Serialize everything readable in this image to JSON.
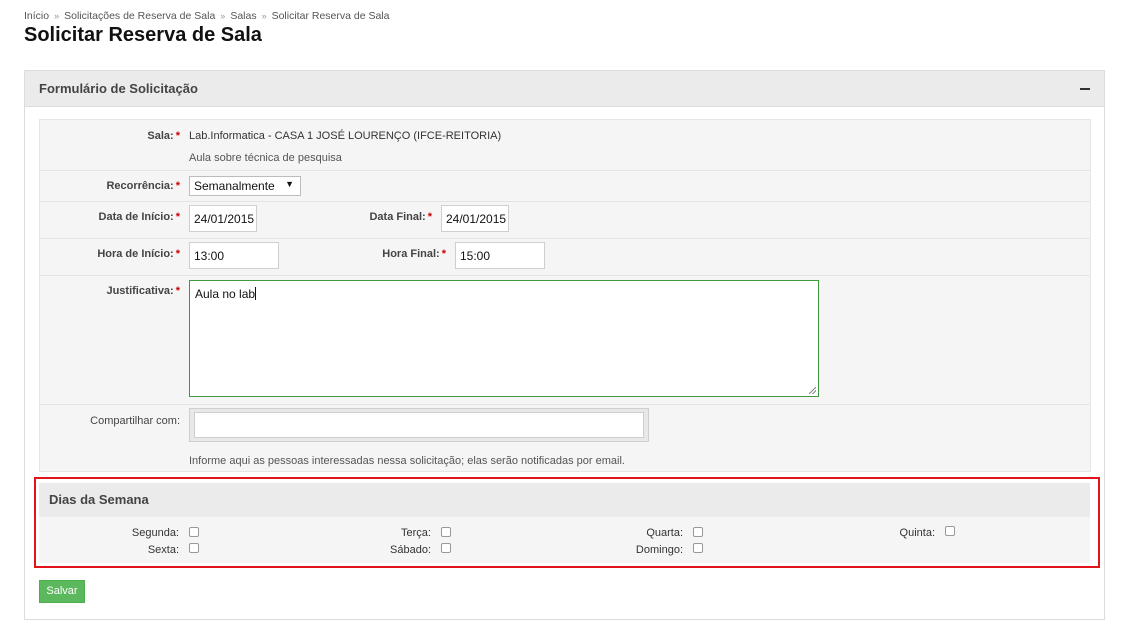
{
  "breadcrumb": {
    "items": [
      "Início",
      "Solicitações de Reserva de Sala",
      "Salas",
      "Solicitar Reserva de Sala"
    ],
    "separator": "»"
  },
  "page_title": "Solicitar Reserva de Sala",
  "panel": {
    "title": "Formulário de Solicitação",
    "collapse_icon": "minus-icon"
  },
  "form": {
    "sala": {
      "label": "Sala:",
      "value": "Lab.Informatica - CASA 1 JOSÉ LOURENÇO (IFCE-REITORIA)",
      "description": "Aula sobre técnica de pesquisa"
    },
    "recorrencia": {
      "label": "Recorrência:",
      "value": "Semanalmente"
    },
    "data_inicio": {
      "label": "Data de Início:",
      "value": "24/01/2015"
    },
    "data_final": {
      "label": "Data Final:",
      "value": "24/01/2015"
    },
    "hora_inicio": {
      "label": "Hora de Início:",
      "value": "13:00"
    },
    "hora_final": {
      "label": "Hora Final:",
      "value": "15:00"
    },
    "justificativa": {
      "label": "Justificativa:",
      "value": "Aula no lab"
    },
    "compartilhar": {
      "label": "Compartilhar com:",
      "value": "",
      "help": "Informe aqui as pessoas interessadas nessa solicitação; elas serão notificadas por email."
    },
    "required_marker": "*"
  },
  "dias_semana": {
    "title": "Dias da Semana",
    "days": [
      {
        "label": "Segunda:",
        "checked": false
      },
      {
        "label": "Terça:",
        "checked": false
      },
      {
        "label": "Quarta:",
        "checked": false
      },
      {
        "label": "Quinta:",
        "checked": false
      },
      {
        "label": "Sexta:",
        "checked": false
      },
      {
        "label": "Sábado:",
        "checked": false
      },
      {
        "label": "Domingo:",
        "checked": false
      }
    ]
  },
  "actions": {
    "save_label": "Salvar"
  },
  "colors": {
    "highlight_border": "#e1141c",
    "save_button": "#5cb85c",
    "required": "#cc0000",
    "textarea_focus": "#3c9a3c"
  }
}
